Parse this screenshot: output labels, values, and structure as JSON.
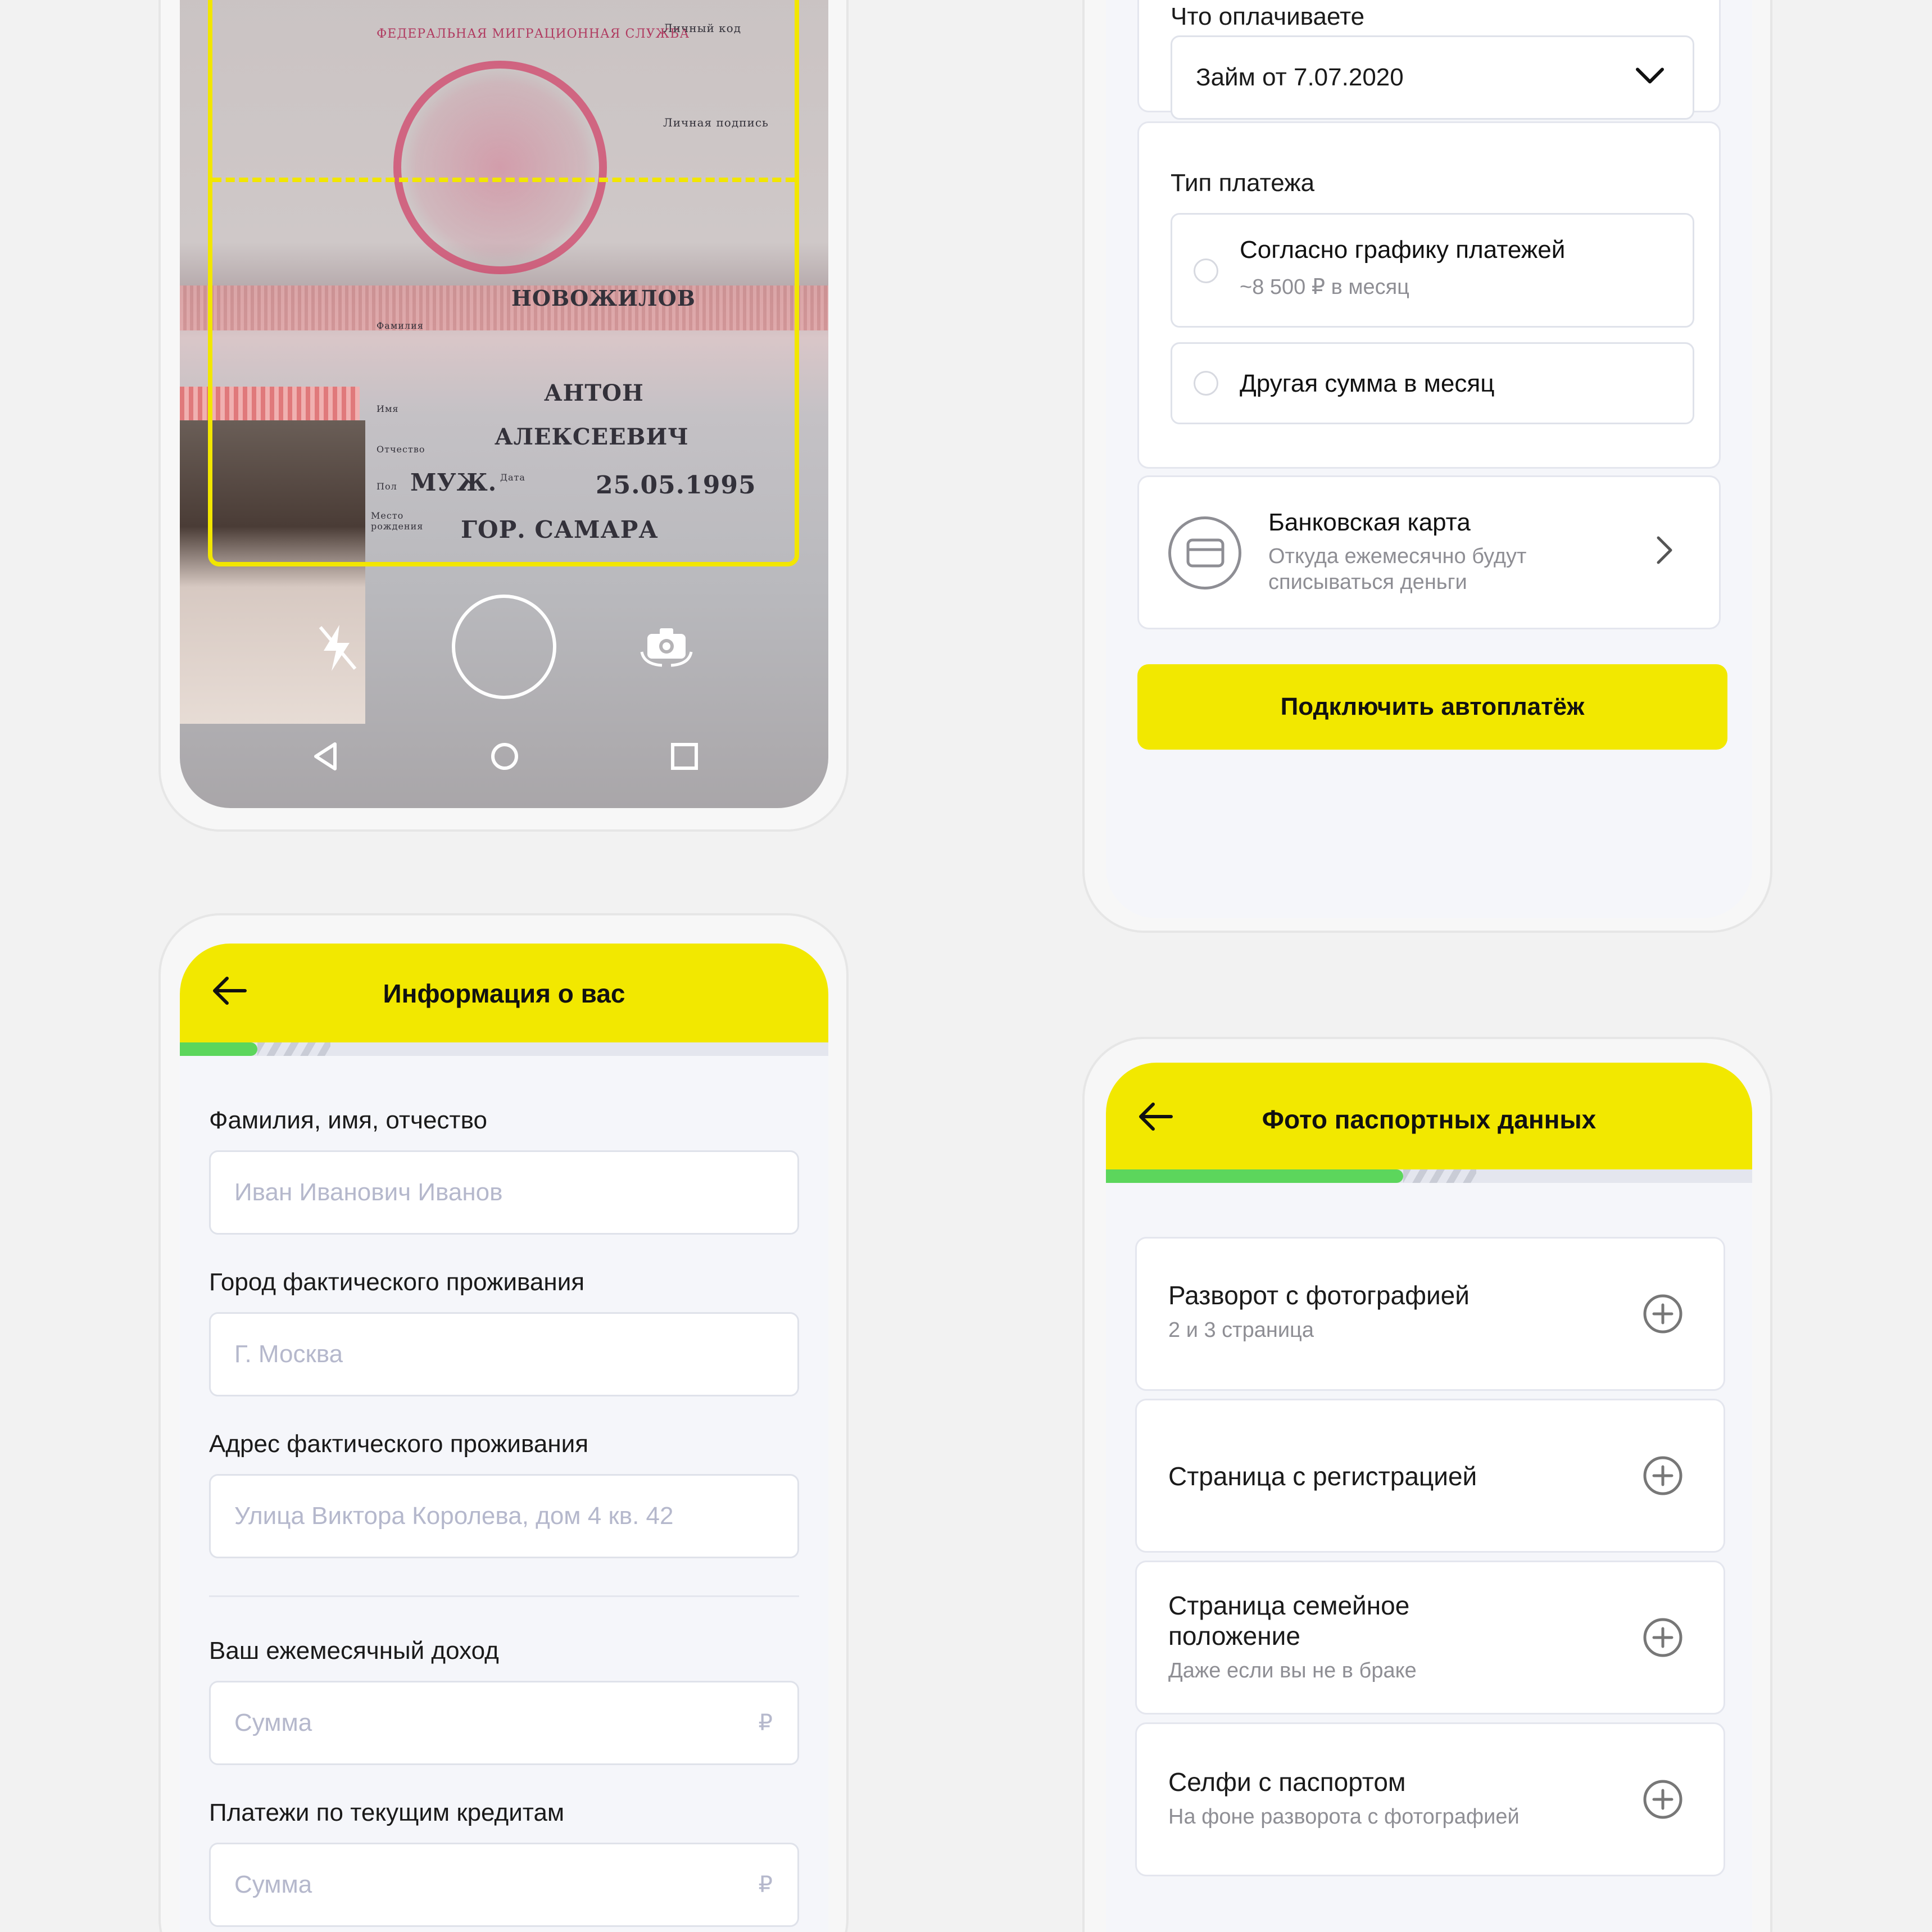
{
  "camera": {
    "doc_surname": "НОВОЖИЛОВ",
    "doc_name": "АНТОН",
    "doc_patronymic": "АЛЕКСЕЕВИЧ",
    "doc_sex": "МУЖ.",
    "doc_birthdate": "25.05.1995",
    "doc_birthplace": "ГОР. САМАРА",
    "doc_field_surname": "Фамилия",
    "doc_field_name": "Имя",
    "doc_field_patronymic": "Отчество",
    "doc_field_sex": "Пол",
    "doc_field_date": "Дата",
    "doc_field_place": "Место рождения",
    "doc_personal_code": "Личный код",
    "doc_signature_label": "Личная подпись",
    "stamp_text": "ФЕДЕРАЛЬНАЯ МИГРАЦИОННАЯ СЛУЖБА"
  },
  "autopay": {
    "what_paying_label": "Что оплачиваете",
    "loan_select_value": "Займ от 7.07.2020",
    "payment_type_label": "Тип платежа",
    "option_schedule_title": "Согласно графику платежей",
    "option_schedule_sub": "~8 500 ₽ в месяц",
    "option_other_title": "Другая сумма в месяц",
    "bank_card_title": "Банковская карта",
    "bank_card_sub_1": "Откуда ежемесячно будут",
    "bank_card_sub_2": "списываться деньги",
    "connect_button": "Подключить автоплатёж"
  },
  "info": {
    "title": "Информация о вас",
    "progress": 0.12,
    "fio_label": "Фамилия, имя, отчество",
    "fio_placeholder": "Иван Иванович Иванов",
    "city_label": "Город фактического проживания",
    "city_placeholder": "Г. Москва",
    "address_label": "Адрес фактического проживания",
    "address_placeholder": "Улица Виктора Королева, дом 4 кв. 42",
    "income_label": "Ваш ежемесячный доход",
    "income_placeholder": "Сумма",
    "credits_label": "Платежи по текущим кредитам",
    "credits_placeholder": "Сумма",
    "currency": "₽"
  },
  "passport": {
    "title": "Фото паспортных данных",
    "progress": 0.46,
    "items": [
      {
        "title": "Разворот с фотографией",
        "sub": "2 и 3 страница"
      },
      {
        "title": "Страница с регистрацией",
        "sub": ""
      },
      {
        "title": "Страница семейное",
        "title2": "положение",
        "sub": "Даже если вы не в браке"
      },
      {
        "title": "Селфи с паспортом",
        "sub": "На фоне разворота с фотографией"
      }
    ]
  },
  "colors": {
    "accent_yellow": "#f2e800",
    "progress_green": "#5cd65c",
    "border": "#e4e6ee",
    "placeholder": "#b5b8cc"
  }
}
